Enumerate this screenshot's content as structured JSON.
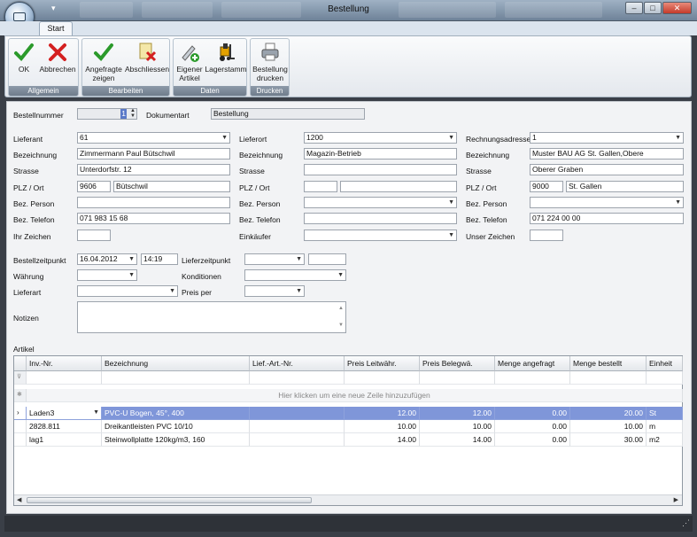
{
  "window": {
    "title": "Bestellung",
    "buttons": [
      "–",
      "□",
      "✕"
    ]
  },
  "qat": {
    "arrow": "▾"
  },
  "ribbon": {
    "tab": "Start",
    "groups": [
      {
        "label": "Allgemein",
        "buttons": [
          {
            "label": "OK",
            "icon": "check-icon"
          },
          {
            "label": "Abbrechen",
            "icon": "cross-icon"
          }
        ]
      },
      {
        "label": "Bearbeiten",
        "buttons": [
          {
            "label": "Angefragte zeigen",
            "l1": "Angefragte",
            "l2": "zeigen",
            "icon": "check-icon"
          },
          {
            "label": "Abschliessen",
            "icon": "doc-cross-icon"
          }
        ]
      },
      {
        "label": "Daten",
        "buttons": [
          {
            "label": "Eigener Artikel",
            "l1": "Eigener",
            "l2": "Artikel",
            "icon": "pencil-plus-icon"
          },
          {
            "label": "Lagerstamm",
            "icon": "forklift-icon"
          }
        ]
      },
      {
        "label": "Drucken",
        "buttons": [
          {
            "label": "Bestellung drucken",
            "l1": "Bestellung",
            "l2": "drucken",
            "icon": "printer-icon"
          }
        ]
      }
    ]
  },
  "header": {
    "bestellnummer_label": "Bestellnummer",
    "bestellnummer_value": "1",
    "dokumentart_label": "Dokumentart",
    "dokumentart_value": "Bestellung"
  },
  "lieferant": {
    "label": "Lieferant",
    "value": "61",
    "bez_label": "Bezeichnung",
    "bez_value": "Zimmermann Paul Bütschwil",
    "strasse_label": "Strasse",
    "strasse_value": "Unterdorfstr. 12",
    "plz_label": "PLZ / Ort",
    "plz_value": "9606",
    "ort_value": "Bütschwil",
    "person_label": "Bez. Person",
    "person_value": "",
    "telefon_label": "Bez. Telefon",
    "telefon_value": "071 983 15 68",
    "zeichen_label": "Ihr Zeichen",
    "zeichen_value": ""
  },
  "lieferort": {
    "label": "Lieferort",
    "value": "1200",
    "bez_label": "Bezeichnung",
    "bez_value": "Magazin-Betrieb",
    "strasse_label": "Strasse",
    "strasse_value": "",
    "plz_label": "PLZ / Ort",
    "plz_value": "",
    "ort_value": "",
    "person_label": "Bez. Person",
    "person_value": "",
    "telefon_label": "Bez. Telefon",
    "telefon_value": "",
    "einkaeufer_label": "Einkäufer",
    "einkaeufer_value": ""
  },
  "rechnung": {
    "label": "Rechnungsadresse",
    "value": "1",
    "bez_label": "Bezeichnung",
    "bez_value": "Muster BAU AG St. Gallen,Obere",
    "strasse_label": "Strasse",
    "strasse_value": "Oberer Graben",
    "plz_label": "PLZ / Ort",
    "plz_value": "9000",
    "ort_value": "St. Gallen",
    "person_label": "Bez. Person",
    "person_value": "",
    "telefon_label": "Bez. Telefon",
    "telefon_value": "071 224 00 00",
    "zeichen_label": "Unser Zeichen",
    "zeichen_value": ""
  },
  "order": {
    "bestellzeit_label": "Bestellzeitpunkt",
    "date": "16.04.2012",
    "time": "14:19",
    "lieferzeit_label": "Lieferzeitpunkt",
    "lieferzeit_date": "",
    "lieferzeit_time": "",
    "waehrung_label": "Währung",
    "waehrung_value": "",
    "konditionen_label": "Konditionen",
    "konditionen_value": "",
    "lieferart_label": "Lieferart",
    "lieferart_value": "",
    "preisper_label": "Preis per",
    "preisper_value": "",
    "notizen_label": "Notizen",
    "notizen_value": ""
  },
  "artikel": {
    "label": "Artikel",
    "columns": [
      "Inv.-Nr.",
      "Bezeichnung",
      "Lief.-Art.-Nr.",
      "Preis Leitwähr.",
      "Preis Belegwä.",
      "Menge angefragt",
      "Menge bestellt",
      "Einheit"
    ],
    "new_row": "Hier klicken um eine neue Zeile hinzuzufügen",
    "rows": [
      {
        "inv": "Laden3",
        "bez": "PVC-U Bogen, 45°, 400",
        "lief": "",
        "leit": "12.00",
        "beleg": "12.00",
        "anfr": "0.00",
        "best": "20.00",
        "einh": "St"
      },
      {
        "inv": "2828.811",
        "bez": "Dreikantleisten PVC 10/10",
        "lief": "",
        "leit": "10.00",
        "beleg": "10.00",
        "anfr": "0.00",
        "best": "10.00",
        "einh": "m"
      },
      {
        "inv": "lag1",
        "bez": "Steinwollplatte  120kg/m3, 160",
        "lief": "",
        "leit": "14.00",
        "beleg": "14.00",
        "anfr": "0.00",
        "best": "30.00",
        "einh": "m2"
      }
    ]
  },
  "colors": {
    "selection": "#7f96d9",
    "titlebar": "#8a9db2",
    "accent": "#2b9a2b"
  }
}
